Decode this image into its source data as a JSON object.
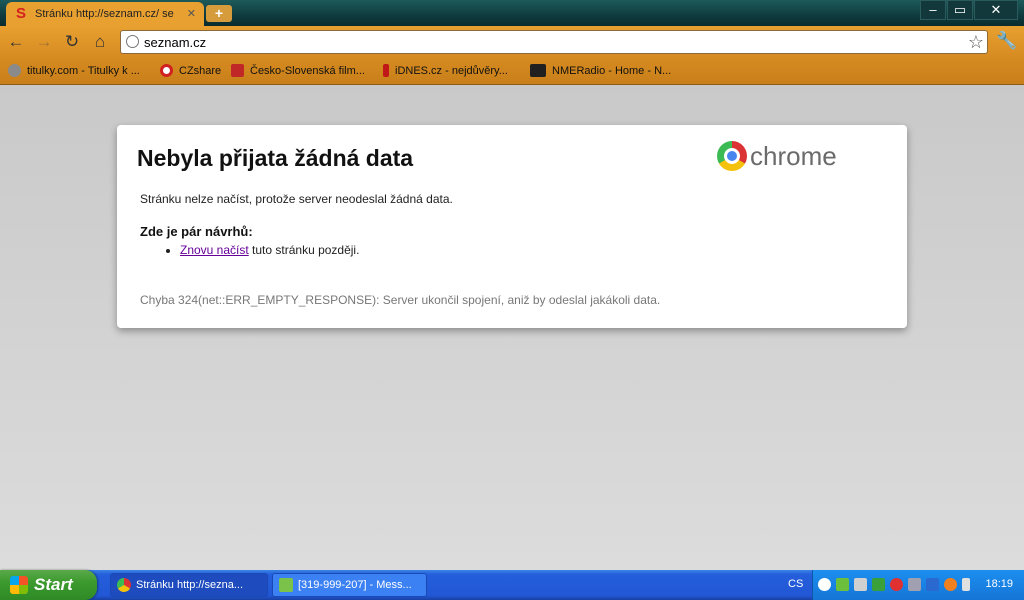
{
  "tab": {
    "title": "Stránku http://seznam.cz/ se",
    "favicon": "seznam-s-icon"
  },
  "window_controls": {
    "minimize": "‒",
    "restore": "▭",
    "close": "✕"
  },
  "toolbar": {
    "back": "←",
    "forward": "→",
    "reload": "↻",
    "home": "⌂",
    "star": "☆",
    "wrench": "🔧"
  },
  "omnibox": {
    "value": "seznam.cz"
  },
  "bookmarks": [
    {
      "label": "titulky.com - Titulky k ...",
      "color": "#7a7a7a"
    },
    {
      "label": "CZshare",
      "color": "#d02020"
    },
    {
      "label": "Česko-Slovenská film...",
      "color": "#c02828"
    },
    {
      "label": "iDNES.cz - nejdůvěry...",
      "color": "#c01818"
    },
    {
      "label": "NMERadio - Home - N...",
      "color": "#202020"
    }
  ],
  "error": {
    "title": "Nebyla přijata žádná data",
    "brand": "chrome",
    "description": "Stránku nelze načíst, protože server neodeslal žádná data.",
    "suggestions_title": "Zde je pár návrhů:",
    "suggestion_link": "Znovu načíst",
    "suggestion_rest": " tuto stránku později.",
    "code": "Chyba 324(net::ERR_EMPTY_RESPONSE): Server ukončil spojení, aniž by odeslal jakákoli data."
  },
  "taskbar": {
    "start_label": "Start",
    "buttons": [
      {
        "label": "Stránku http://sezna..."
      },
      {
        "label": "[319-999-207] - Mess..."
      }
    ],
    "language": "CS",
    "clock": "18:19"
  }
}
